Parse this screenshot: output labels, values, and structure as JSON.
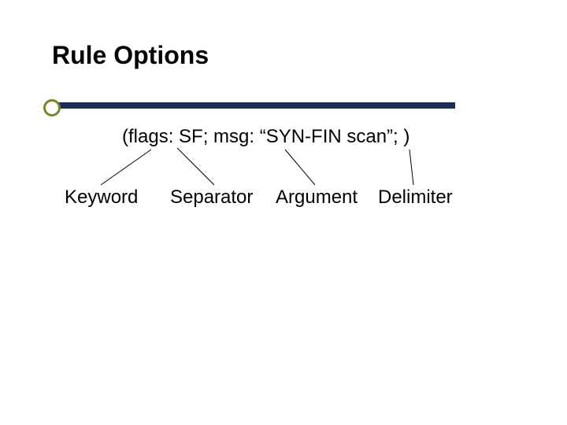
{
  "title": "Rule Options",
  "example": "(flags: SF; msg: “SYN-FIN scan”; )",
  "labels": {
    "keyword": "Keyword",
    "separator": "Separator",
    "argument": "Argument",
    "delimiter": "Delimiter"
  }
}
